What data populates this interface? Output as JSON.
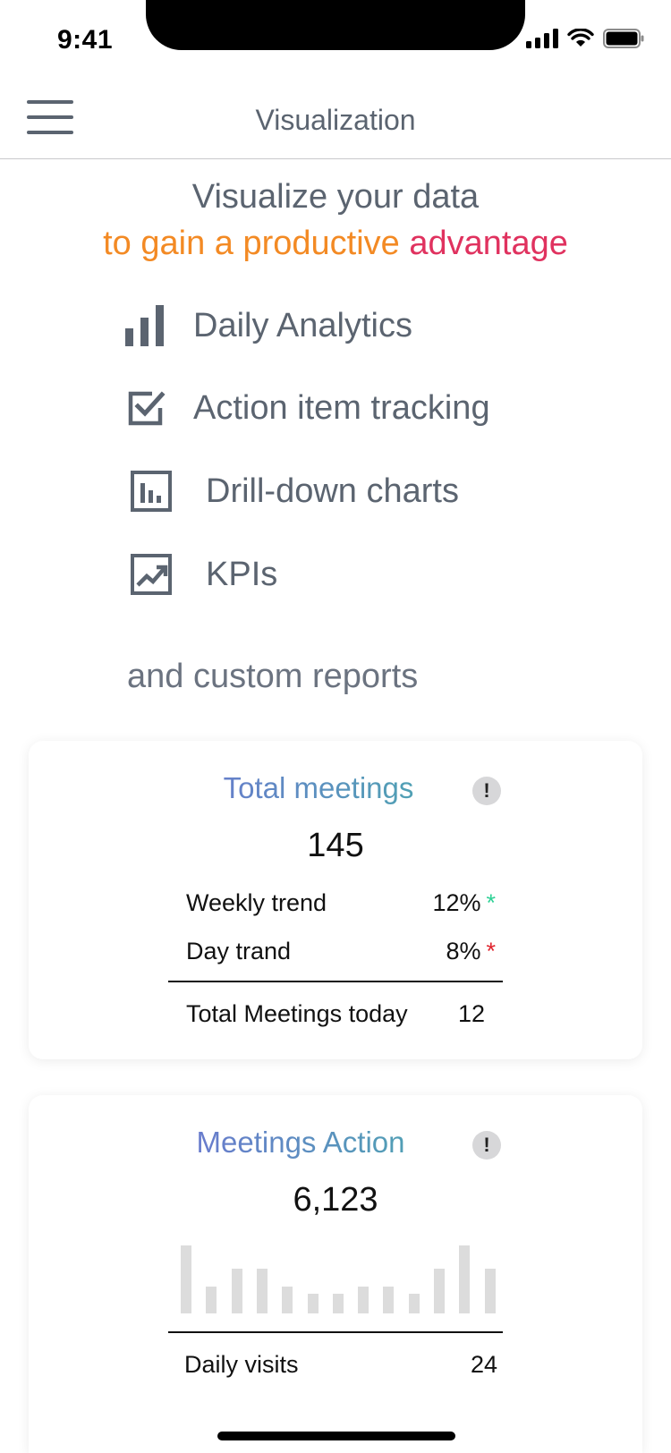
{
  "status_bar": {
    "time": "9:41"
  },
  "header": {
    "title": "Visualization"
  },
  "hero": {
    "line1": "Visualize your data",
    "line2_part1": "to gain a productive",
    "line2_part2": "advantage"
  },
  "features": [
    {
      "label": "Daily Analytics",
      "icon": "bar-chart-icon"
    },
    {
      "label": "Action item tracking",
      "icon": "checkbox-icon"
    },
    {
      "label": "Drill-down charts",
      "icon": "chart-box-icon"
    },
    {
      "label": "KPIs",
      "icon": "trending-up-icon"
    }
  ],
  "custom_reports": "and custom reports",
  "card_meetings": {
    "title": "Total meetings",
    "info": "!",
    "value": "145",
    "rows": [
      {
        "label": "Weekly trend",
        "value": "12%",
        "marker": "*"
      },
      {
        "label": "Day trand",
        "value": "8%",
        "marker": "*"
      }
    ],
    "footer_label": "Total Meetings today",
    "footer_value": "12"
  },
  "card_actions": {
    "title": "Meetings Action",
    "info": "!",
    "value": "6,123",
    "footer_label": "Daily visits",
    "footer_value": "24"
  },
  "colors": {
    "text_gray": "#5b6470",
    "accent_orange": "#f38a24",
    "accent_pink": "#e0325f",
    "trend_up": "#2fd196",
    "trend_down": "#e0252f",
    "bar_gray": "#dcdcdc"
  },
  "chart_data": {
    "type": "bar",
    "values": [
      76,
      30,
      50,
      50,
      30,
      22,
      22,
      30,
      30,
      22,
      50,
      76,
      50
    ]
  }
}
